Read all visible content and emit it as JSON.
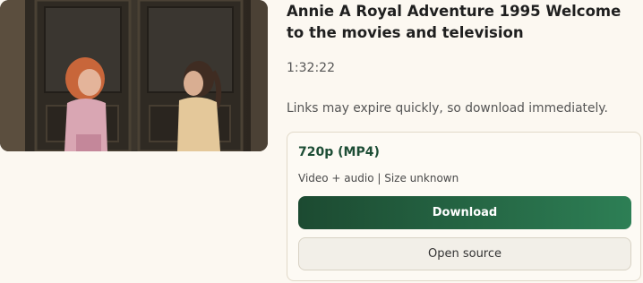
{
  "video": {
    "title": "Annie A Royal Adventure 1995 Welcome to the movies and television",
    "duration": "1:32:22",
    "thumbnail_icon": "video-thumbnail"
  },
  "notice": "Links may expire quickly, so download immediately.",
  "download_option": {
    "format": "720p (MP4)",
    "meta": "Video + audio | Size unknown",
    "download_label": "Download",
    "open_source_label": "Open source"
  },
  "colors": {
    "background": "#fcf8f1",
    "accent_dark": "#1c4a31",
    "accent_light": "#2d7f55",
    "format_text": "#1d4d35"
  }
}
